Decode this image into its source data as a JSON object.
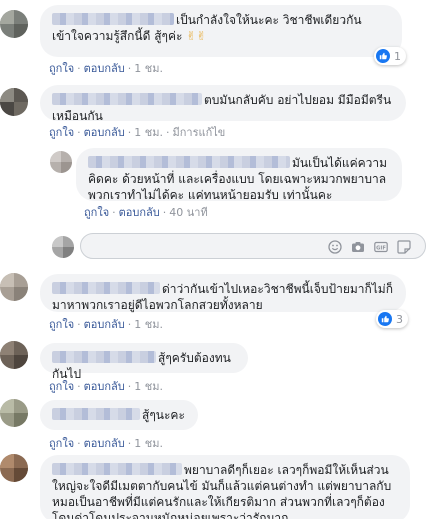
{
  "actions": {
    "like": "ถูกใจ",
    "reply": "ตอบกลับ",
    "edited": "มีการแก้ไข"
  },
  "comments": [
    {
      "text": "เป็นกำลังใจให้นะคะ วิชาชีพเดียวกันเข้าใจความรู้สึกนี้ดี สู้ๆค่ะ",
      "emoji": "✌✌",
      "time": "1 ชม.",
      "reactions": "1"
    },
    {
      "text": "ตบมันกลับคับ อย่าไปยอม มีมือมีตรีนเหมือนกัน",
      "time": "1 ชม."
    },
    {
      "text": "มันเป็นได้แค่ความคิดคะ ด้วยหน้าที่ และเครื่องแบบ โดยเฉพาะหมวกพยาบาลพวกเราทำไม่ได้คะ แค่ทนหน้ายอมรับ เท่านั้นคะ",
      "time": "40 นาที"
    },
    {
      "text": "ด่าว่ากันเข้าไปเหอะวิชาชีพนี้เจ็บป้ายมาก็ไม่ก็มาหาพวกเราอยู่ดีไอพวกโลกสวยทั้งหลาย",
      "time": "1 ชม.",
      "reactions": "3"
    },
    {
      "text": "สู้ๆครับต้องทนกันไป",
      "time": "1 ชม."
    },
    {
      "text": "สู้ๆนะคะ",
      "time": "1 ชม."
    },
    {
      "text": "พยาบาลดีๆก็เยอะ เลวๆก็พอมีให้เห็นส่วนใหญ่จะใจดีมีเมตตากับคนไข้ มันก็แล้วแต่คนต่างทำ แต่พยาบาลกับหมอเป็นอาชีพที่มีแต่คนรักและให้เกียรติมาก ส่วนพวกที่เลวๆก็ต้องโดนด่าโดนประจานหนักหน่อยเพราะว่ารักมาก"
    }
  ]
}
